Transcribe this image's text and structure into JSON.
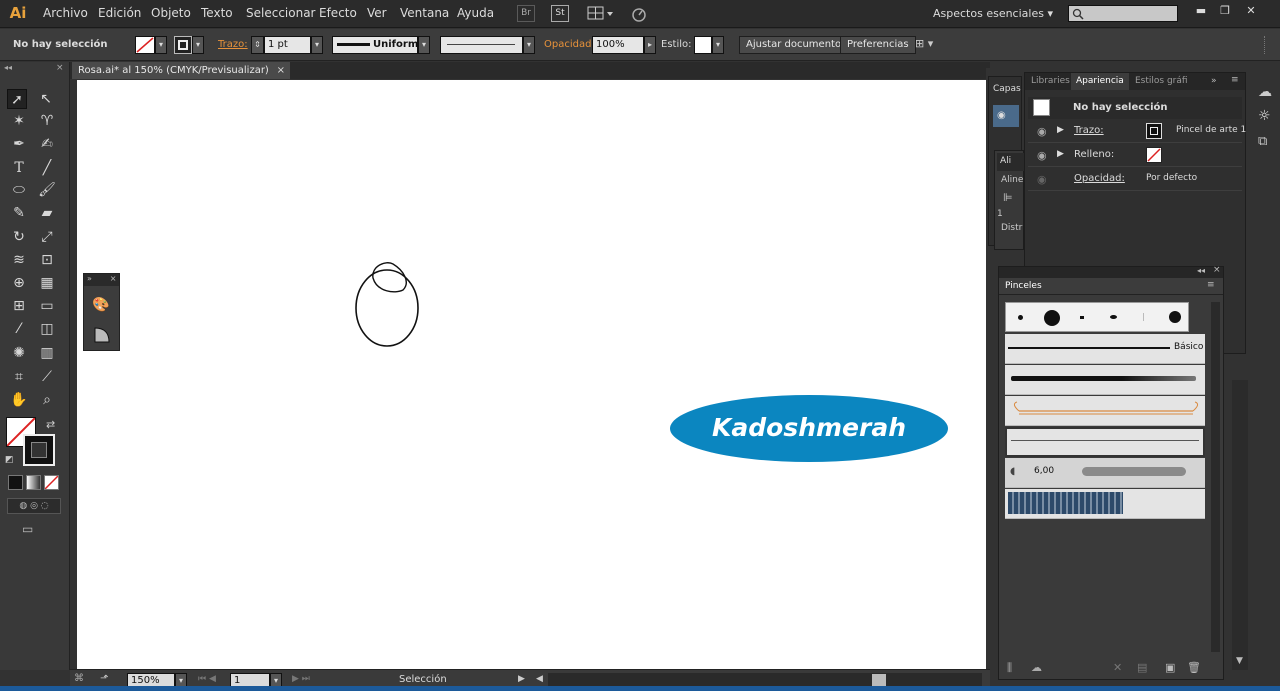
{
  "app": {
    "logo": "Ai"
  },
  "menu": [
    "Archivo",
    "Edición",
    "Objeto",
    "Texto",
    "Seleccionar",
    "Efecto",
    "Ver",
    "Ventana",
    "Ayuda"
  ],
  "menubar_icons": {
    "bridge": "Br",
    "stock": "St"
  },
  "workspace": {
    "label": "Aspectos esenciales"
  },
  "window_controls": {
    "minimize": "▬",
    "restore": "❐",
    "close": "✕"
  },
  "control": {
    "selection_status": "No hay selección",
    "stroke_label": "Trazo:",
    "stroke_weight": "1 pt",
    "profile": "Uniforme",
    "opacity_label": "Opacidad:",
    "opacity_value": "100%",
    "style_label": "Estilo:",
    "doc_setup_button": "Ajustar documento",
    "prefs_button": "Preferencias"
  },
  "document": {
    "tab_title": "Rosa.ai* al 150% (CMYK/Previsualizar)",
    "close_icon": "×"
  },
  "canvas": {
    "logo_text": "Kadoshmerah",
    "logo_color": "#0b86c0"
  },
  "layers_panel": {
    "title": "Capas"
  },
  "align_panel": {
    "title": "Ali",
    "align_label": "Aline",
    "distribute_label": "Distr",
    "number": "1"
  },
  "appearance": {
    "tabs": [
      "Libraries",
      "Apariencia",
      "Estilos gráfi"
    ],
    "header": "No hay selección",
    "rows": [
      {
        "label": "Trazo:",
        "value": "Pincel de arte 1"
      },
      {
        "label": "Relleno:",
        "value": ""
      },
      {
        "label": "Opacidad:",
        "value": "Por defecto"
      }
    ]
  },
  "brushes": {
    "title": "Pinceles",
    "basic_label": "Básico",
    "size_label": "6,00"
  },
  "status": {
    "zoom": "150%",
    "artboard": "1",
    "tool": "Selección"
  },
  "colors": {
    "accent_orange": "#e8923a",
    "panel_dark": "#323232",
    "canvas": "#ffffff"
  }
}
